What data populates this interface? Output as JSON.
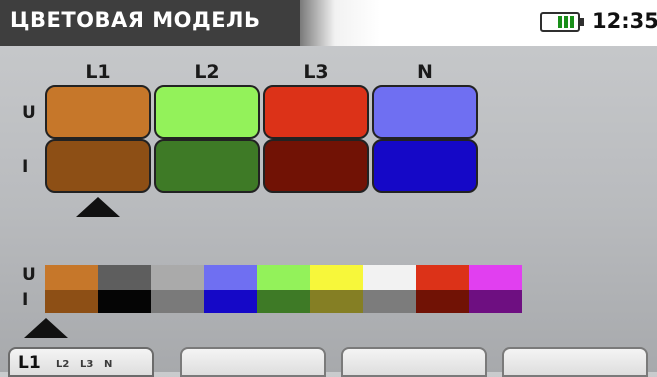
{
  "header": {
    "title": "ЦВЕТОВАЯ МОДЕЛЬ",
    "time": "12:35",
    "battery_icon": "battery-icon"
  },
  "grid": {
    "columns": [
      "L1",
      "L2",
      "L3",
      "N"
    ],
    "row_labels": [
      "U",
      "I"
    ],
    "u_colors": [
      "#c6772a",
      "#93f25a",
      "#dc3218",
      "#6f6ff2"
    ],
    "i_colors": [
      "#8d4f15",
      "#3e7a26",
      "#711205",
      "#1508c7"
    ],
    "selected_column": "L1"
  },
  "palette": {
    "row_labels": [
      "U",
      "I"
    ],
    "u_colors": [
      "#c6772a",
      "#5e5e5e",
      "#aaaaaa",
      "#6f6ff2",
      "#93f25a",
      "#f7f73a",
      "#f2f2f2",
      "#dc3218",
      "#e13ff0"
    ],
    "i_colors": [
      "#8d4f15",
      "#050505",
      "#7a7a7a",
      "#1508c7",
      "#3e7a26",
      "#857f24",
      "#7c7c7c",
      "#711205",
      "#6e0f81"
    ],
    "selected_index": 0
  },
  "softkeys": [
    {
      "main": "L1",
      "sub": [
        "L2",
        "L3",
        "N"
      ]
    },
    {
      "main": "",
      "sub": []
    },
    {
      "main": "",
      "sub": []
    },
    {
      "main": "",
      "sub": []
    }
  ]
}
